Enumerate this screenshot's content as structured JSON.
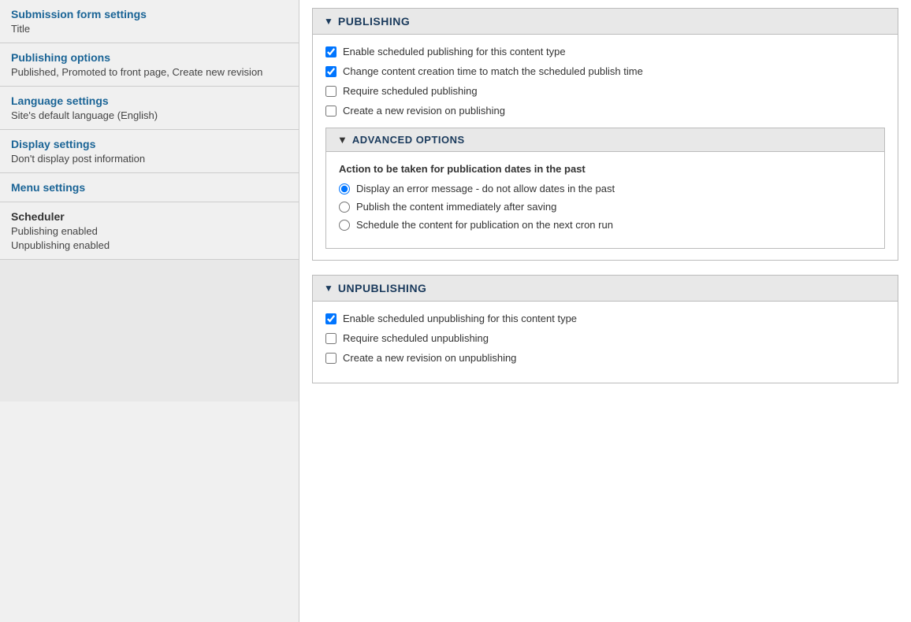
{
  "sidebar": {
    "items": [
      {
        "id": "submission-form-settings",
        "title": "Submission form settings",
        "subtext": "Title"
      },
      {
        "id": "publishing-options",
        "title": "Publishing options",
        "subtext": "Published, Promoted to front page, Create new revision"
      },
      {
        "id": "language-settings",
        "title": "Language settings",
        "subtext": "Site's default language (English)"
      },
      {
        "id": "display-settings",
        "title": "Display settings",
        "subtext": "Don't display post information"
      },
      {
        "id": "menu-settings",
        "title": "Menu settings",
        "subtext": ""
      }
    ],
    "scheduler": {
      "title": "Scheduler",
      "subtext1": "Publishing enabled",
      "subtext2": "Unpublishing enabled"
    }
  },
  "publishing_section": {
    "header": "PUBLISHING",
    "triangle": "▼",
    "checkboxes": [
      {
        "id": "enable-scheduled-publishing",
        "label": "Enable scheduled publishing for this content type",
        "checked": true
      },
      {
        "id": "change-content-creation-time",
        "label": "Change content creation time to match the scheduled publish time",
        "checked": true
      },
      {
        "id": "require-scheduled-publishing",
        "label": "Require scheduled publishing",
        "checked": false
      },
      {
        "id": "create-new-revision-publishing",
        "label": "Create a new revision on publishing",
        "checked": false
      }
    ],
    "advanced": {
      "header": "ADVANCED OPTIONS",
      "triangle": "▼",
      "action_label": "Action to be taken for publication dates in the past",
      "radios": [
        {
          "id": "radio-error",
          "label": "Display an error message - do not allow dates in the past",
          "checked": true
        },
        {
          "id": "radio-publish-immediately",
          "label": "Publish the content immediately after saving",
          "checked": false
        },
        {
          "id": "radio-schedule-cron",
          "label": "Schedule the content for publication on the next cron run",
          "checked": false
        }
      ]
    }
  },
  "unpublishing_section": {
    "header": "UNPUBLISHING",
    "triangle": "▼",
    "checkboxes": [
      {
        "id": "enable-scheduled-unpublishing",
        "label": "Enable scheduled unpublishing for this content type",
        "checked": true
      },
      {
        "id": "require-scheduled-unpublishing",
        "label": "Require scheduled unpublishing",
        "checked": false
      },
      {
        "id": "create-new-revision-unpublishing",
        "label": "Create a new revision on unpublishing",
        "checked": false
      }
    ]
  }
}
